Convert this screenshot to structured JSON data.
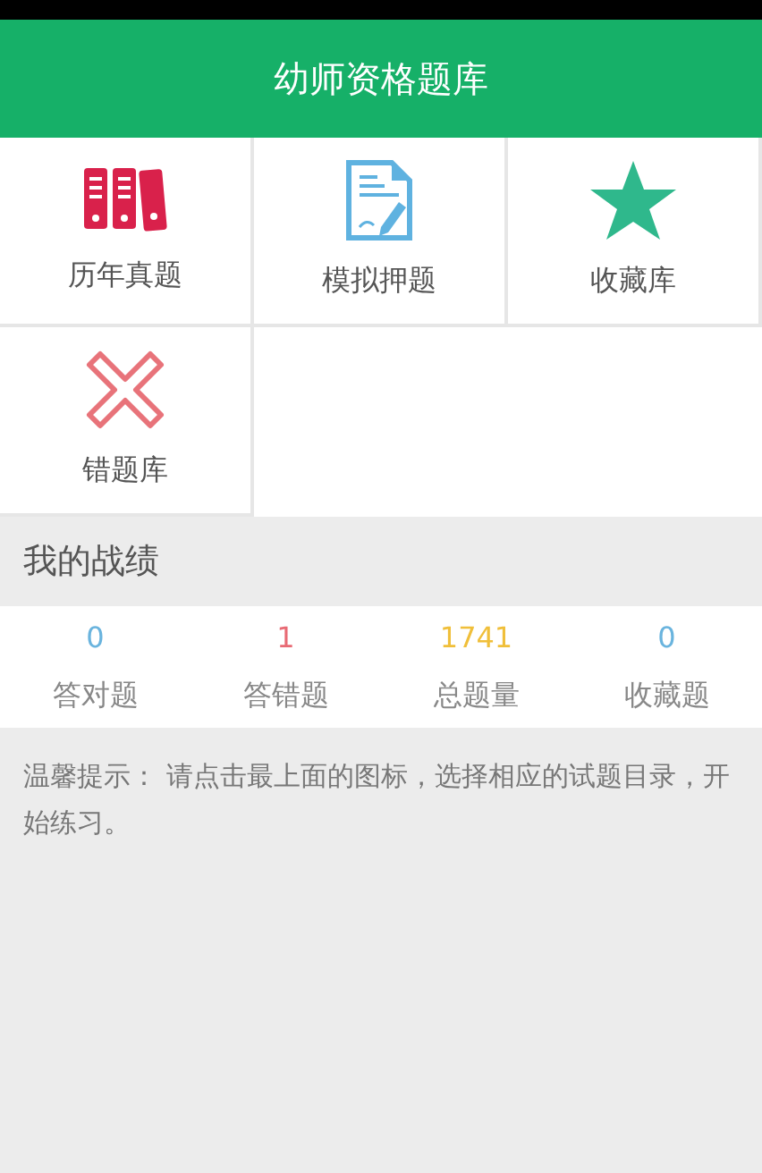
{
  "header": {
    "title": "幼师资格题库"
  },
  "menu": [
    {
      "label": "历年真题",
      "kind": "binders"
    },
    {
      "label": "模拟押题",
      "kind": "document"
    },
    {
      "label": "收藏库",
      "kind": "star"
    },
    {
      "label": "错题库",
      "kind": "cross"
    }
  ],
  "record": {
    "title": "我的战绩",
    "stats": [
      {
        "value": "0",
        "label": "答对题",
        "color": "#6ab4de"
      },
      {
        "value": "1",
        "label": "答错题",
        "color": "#e86a74"
      },
      {
        "value": "1741",
        "label": "总题量",
        "color": "#f0bf3a"
      },
      {
        "value": "0",
        "label": "收藏题",
        "color": "#6ab4de"
      }
    ]
  },
  "tip": "温馨提示： 请点击最上面的图标，选择相应的试题目录，开始练习。"
}
